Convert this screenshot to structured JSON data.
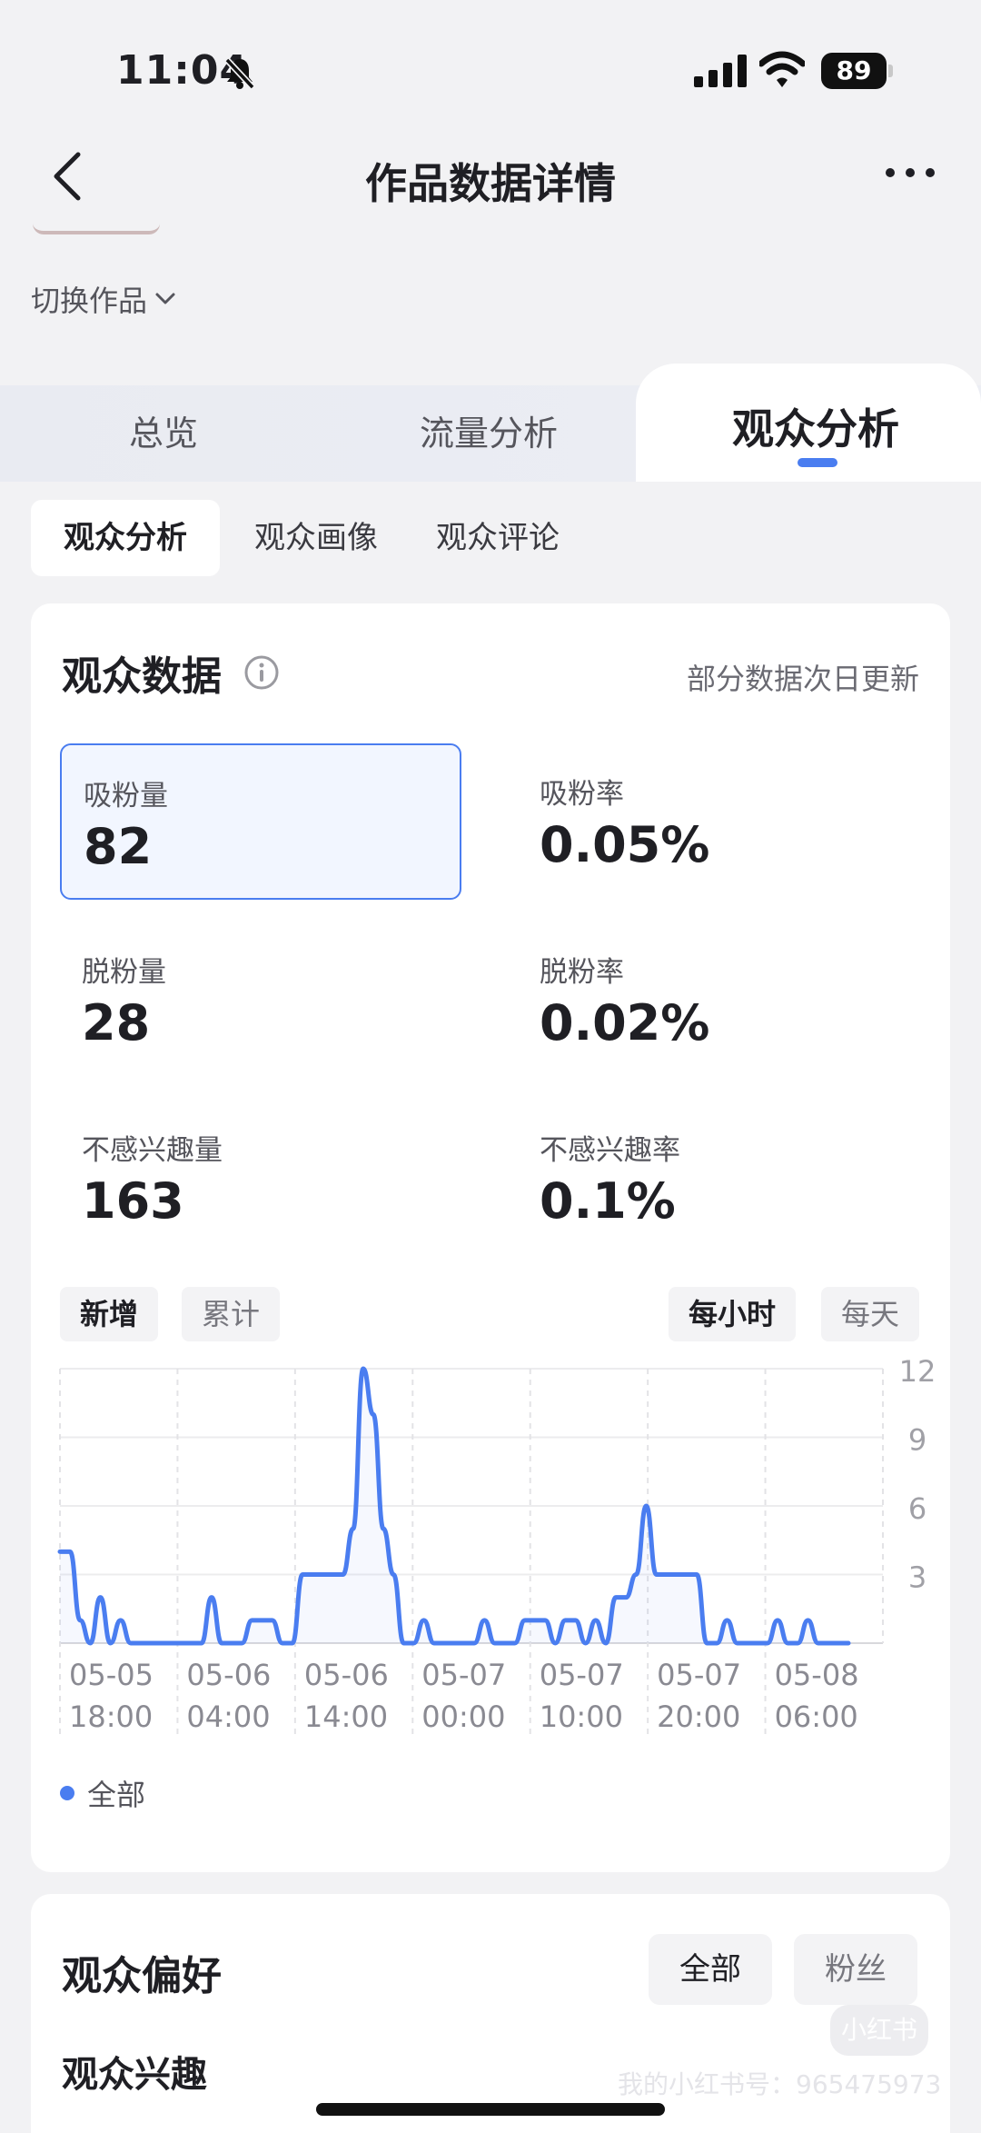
{
  "status_bar": {
    "time": "11:04",
    "battery": "89"
  },
  "nav": {
    "title": "作品数据详情"
  },
  "switch_work": {
    "label": "切换作品"
  },
  "main_tabs": [
    {
      "label": "总览",
      "active": false
    },
    {
      "label": "流量分析",
      "active": false
    },
    {
      "label": "观众分析",
      "active": true
    }
  ],
  "sub_tabs": [
    {
      "label": "观众分析",
      "active": true
    },
    {
      "label": "观众画像",
      "active": false
    },
    {
      "label": "观众评论",
      "active": false
    }
  ],
  "audience_card": {
    "title": "观众数据",
    "note": "部分数据次日更新",
    "metrics": [
      {
        "label": "吸粉量",
        "value": "82",
        "selected": true
      },
      {
        "label": "吸粉率",
        "value": "0.05%"
      },
      {
        "label": "脱粉量",
        "value": "28"
      },
      {
        "label": "脱粉率",
        "value": "0.02%"
      },
      {
        "label": "不感兴趣量",
        "value": "163"
      },
      {
        "label": "不感兴趣率",
        "value": "0.1%"
      }
    ],
    "mode_toggle": [
      {
        "label": "新增",
        "active": true
      },
      {
        "label": "累计",
        "active": false
      }
    ],
    "granularity_toggle": [
      {
        "label": "每小时",
        "active": true
      },
      {
        "label": "每天",
        "active": false
      }
    ],
    "legend": "全部"
  },
  "chart_data": {
    "type": "line",
    "series": [
      {
        "name": "全部",
        "color": "#4a7df0",
        "values": [
          4,
          4,
          1,
          0,
          2,
          0,
          1,
          0,
          0,
          0,
          0,
          0,
          0,
          0,
          0,
          2,
          0,
          0,
          0,
          1,
          1,
          1,
          0,
          0,
          3,
          3,
          3,
          3,
          3,
          5,
          12,
          10,
          5,
          3,
          0,
          0,
          1,
          0,
          0,
          0,
          0,
          0,
          1,
          0,
          0,
          0,
          1,
          1,
          1,
          0,
          1,
          1,
          0,
          1,
          0,
          2,
          2,
          3,
          6,
          3,
          3,
          3,
          3,
          3,
          0,
          0,
          1,
          0,
          0,
          0,
          0,
          1,
          0,
          0,
          1,
          0,
          0,
          0,
          0
        ]
      }
    ],
    "x_tick_labels": [
      [
        "05-05",
        "18:00"
      ],
      [
        "05-06",
        "04:00"
      ],
      [
        "05-06",
        "14:00"
      ],
      [
        "05-07",
        "00:00"
      ],
      [
        "05-07",
        "10:00"
      ],
      [
        "05-07",
        "20:00"
      ],
      [
        "05-08",
        "06:00"
      ]
    ],
    "y_ticks": [
      3,
      6,
      9,
      12
    ],
    "ylim": [
      0,
      12
    ],
    "grid": true,
    "legend_position": "bottom-left"
  },
  "preference_card": {
    "title": "观众偏好",
    "buttons": [
      {
        "label": "全部",
        "active": true
      },
      {
        "label": "粉丝",
        "active": false
      }
    ],
    "interest_title": "观众兴趣"
  },
  "watermark": {
    "text": "我的小红书号：965475973",
    "logo": "小红书"
  },
  "colors": {
    "accent": "#4a7df0",
    "background": "#f2f2f4",
    "card": "#ffffff"
  }
}
